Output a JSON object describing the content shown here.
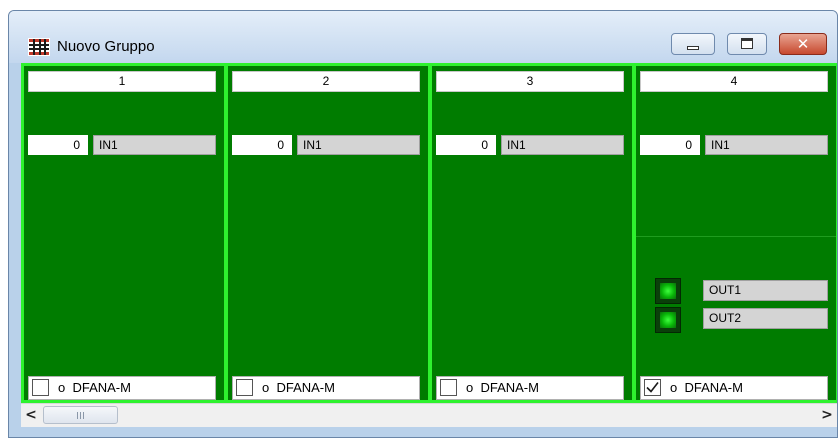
{
  "window": {
    "title": "Nuovo Gruppo",
    "icon": "grid-app-icon",
    "controls": [
      "minimize-icon",
      "maximize-icon",
      "close-icon"
    ],
    "close_glyph": "✕"
  },
  "panels": [
    {
      "header": "1",
      "input": {
        "value": "0",
        "label": "IN1"
      },
      "outputs": [],
      "checked": false,
      "footer_label": "o  DFANA-M"
    },
    {
      "header": "2",
      "input": {
        "value": "0",
        "label": "IN1"
      },
      "outputs": [],
      "checked": false,
      "footer_label": "o  DFANA-M"
    },
    {
      "header": "3",
      "input": {
        "value": "0",
        "label": "IN1"
      },
      "outputs": [],
      "checked": false,
      "footer_label": "o  DFANA-M"
    },
    {
      "header": "4",
      "input": {
        "value": "0",
        "label": "IN1"
      },
      "outputs": [
        {
          "label": "OUT1"
        },
        {
          "label": "OUT2"
        }
      ],
      "checked": true,
      "footer_label": "o  DFANA-M"
    }
  ],
  "scrollbar": {
    "left_arrow": "<",
    "right_arrow": ">"
  },
  "colors": {
    "panel_bg": "#007c00",
    "panel_border": "#2ef22e",
    "client_bg": "#006e00",
    "led_on": "#3dff3d"
  }
}
